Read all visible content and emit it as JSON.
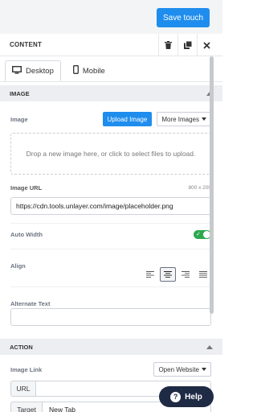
{
  "topbar": {
    "save_label": "Save touch"
  },
  "panel": {
    "title": "CONTENT"
  },
  "tabs": [
    {
      "label": "Desktop",
      "active": true
    },
    {
      "label": "Mobile",
      "active": false
    }
  ],
  "image_section": {
    "title": "IMAGE",
    "image_label": "Image",
    "upload_label": "Upload Image",
    "more_images_label": "More Images",
    "dropzone_text": "Drop a new image here, or click to select files to upload.",
    "url_label": "Image URL",
    "size_text": "800 x 200",
    "url_value": "https://cdn.tools.unlayer.com/image/placeholder.png",
    "auto_width_label": "Auto Width",
    "auto_width_on": true,
    "align_label": "Align",
    "align_selected": "center",
    "alt_label": "Alternate Text",
    "alt_value": ""
  },
  "action_section": {
    "title": "ACTION",
    "link_label": "Image Link",
    "link_type": "Open Website",
    "url_key": "URL",
    "url_value": "",
    "target_key": "Target",
    "target_value": "New Tab"
  },
  "help": {
    "label": "Help"
  },
  "colors": {
    "accent": "#1f8ded",
    "toggle_on": "#2ea84f",
    "help_bg": "#1f2a44"
  }
}
